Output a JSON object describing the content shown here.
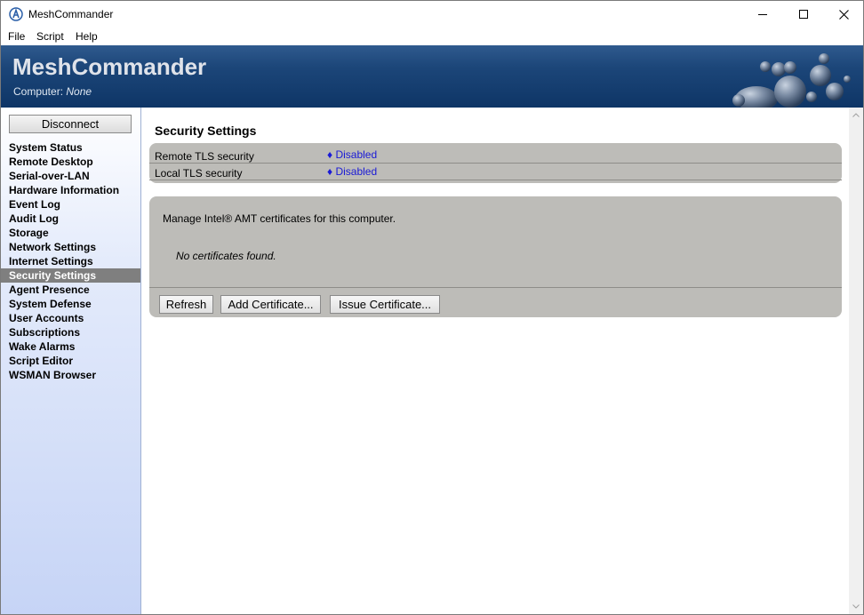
{
  "window": {
    "title": "MeshCommander"
  },
  "menu": {
    "items": [
      "File",
      "Script",
      "Help"
    ]
  },
  "banner": {
    "title": "MeshCommander",
    "computer_label": "Computer:",
    "computer_value": "None"
  },
  "sidebar": {
    "disconnect_label": "Disconnect",
    "items": [
      {
        "label": "System Status",
        "active": false
      },
      {
        "label": "Remote Desktop",
        "active": false
      },
      {
        "label": "Serial-over-LAN",
        "active": false
      },
      {
        "label": "Hardware Information",
        "active": false
      },
      {
        "label": "Event Log",
        "active": false
      },
      {
        "label": "Audit Log",
        "active": false
      },
      {
        "label": "Storage",
        "active": false
      },
      {
        "label": "Network Settings",
        "active": false
      },
      {
        "label": "Internet Settings",
        "active": false
      },
      {
        "label": "Security Settings",
        "active": true
      },
      {
        "label": "Agent Presence",
        "active": false
      },
      {
        "label": "System Defense",
        "active": false
      },
      {
        "label": "User Accounts",
        "active": false
      },
      {
        "label": "Subscriptions",
        "active": false
      },
      {
        "label": "Wake Alarms",
        "active": false
      },
      {
        "label": "Script Editor",
        "active": false
      },
      {
        "label": "WSMAN Browser",
        "active": false
      }
    ]
  },
  "main": {
    "title": "Security Settings",
    "tls": [
      {
        "label": "Remote TLS security",
        "value": "♦ Disabled"
      },
      {
        "label": "Local TLS security",
        "value": "♦ Disabled"
      }
    ],
    "certificates": {
      "description": "Manage Intel® AMT certificates for this computer.",
      "empty_message": "No certificates found.",
      "refresh_label": "Refresh",
      "add_label": "Add Certificate...",
      "issue_label": "Issue Certificate..."
    }
  },
  "colors": {
    "banner_dark": "#0e3566",
    "link_blue": "#1a1ad6",
    "panel_gray": "#bdbcb8",
    "active_nav": "#7f7f7f"
  }
}
